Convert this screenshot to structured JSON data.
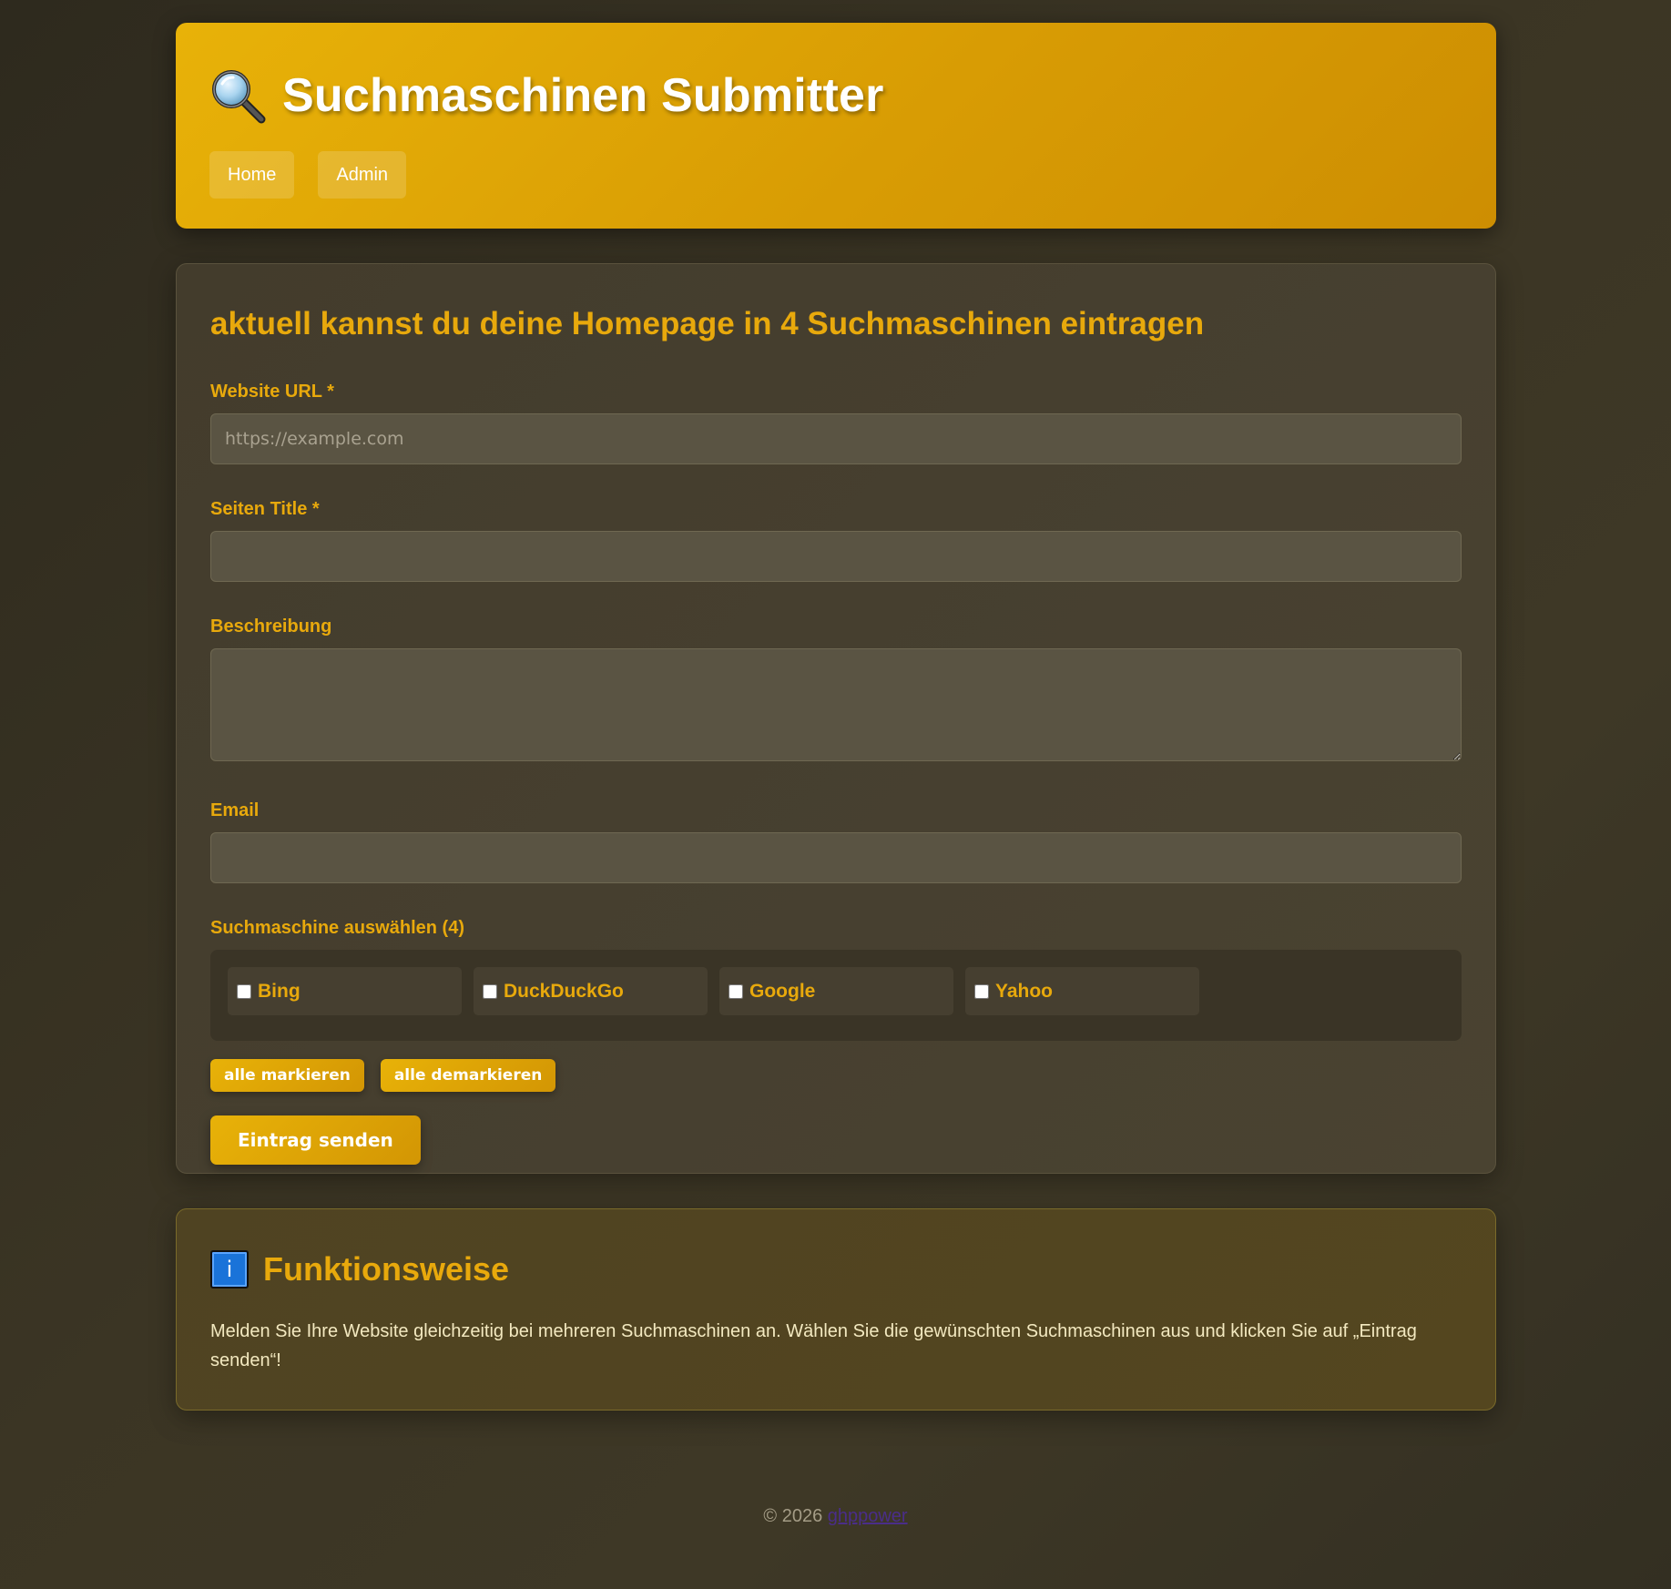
{
  "header": {
    "title": "Suchmaschinen Submitter",
    "icon": "magnifier-icon",
    "nav": [
      {
        "label": "Home"
      },
      {
        "label": "Admin"
      }
    ]
  },
  "form": {
    "heading": "aktuell kannst du deine Homepage in 4 Suchmaschinen eintragen",
    "url_label": "Website URL *",
    "url_placeholder": "https://example.com",
    "url_value": "",
    "title_label": "Seiten Title *",
    "title_value": "",
    "desc_label": "Beschreibung",
    "desc_value": "",
    "email_label": "Email",
    "email_value": "",
    "engines_label": "Suchmaschine auswählen (4)",
    "engines": [
      {
        "name": "Bing",
        "checked": false
      },
      {
        "name": "DuckDuckGo",
        "checked": false
      },
      {
        "name": "Google",
        "checked": false
      },
      {
        "name": "Yahoo",
        "checked": false
      }
    ],
    "select_all_label": "alle markieren",
    "deselect_all_label": "alle demarkieren",
    "submit_label": "Eintrag senden"
  },
  "info": {
    "icon": "info-icon",
    "icon_glyph": "i",
    "title": "Funktionsweise",
    "text": "Melden Sie Ihre Website gleichzeitig bei mehreren Suchmaschinen an. Wählen Sie die gewünschten Suchmaschinen aus und klicken Sie auf „Eintrag senden“!"
  },
  "footer": {
    "copyright": "© 2026",
    "link_text": "ghppower"
  },
  "colors": {
    "accent": "#e8a90c",
    "header_bg": "#dca205",
    "card_bg": "#454030",
    "info_bg": "#524520",
    "footer_link": "#4a2d8a"
  }
}
